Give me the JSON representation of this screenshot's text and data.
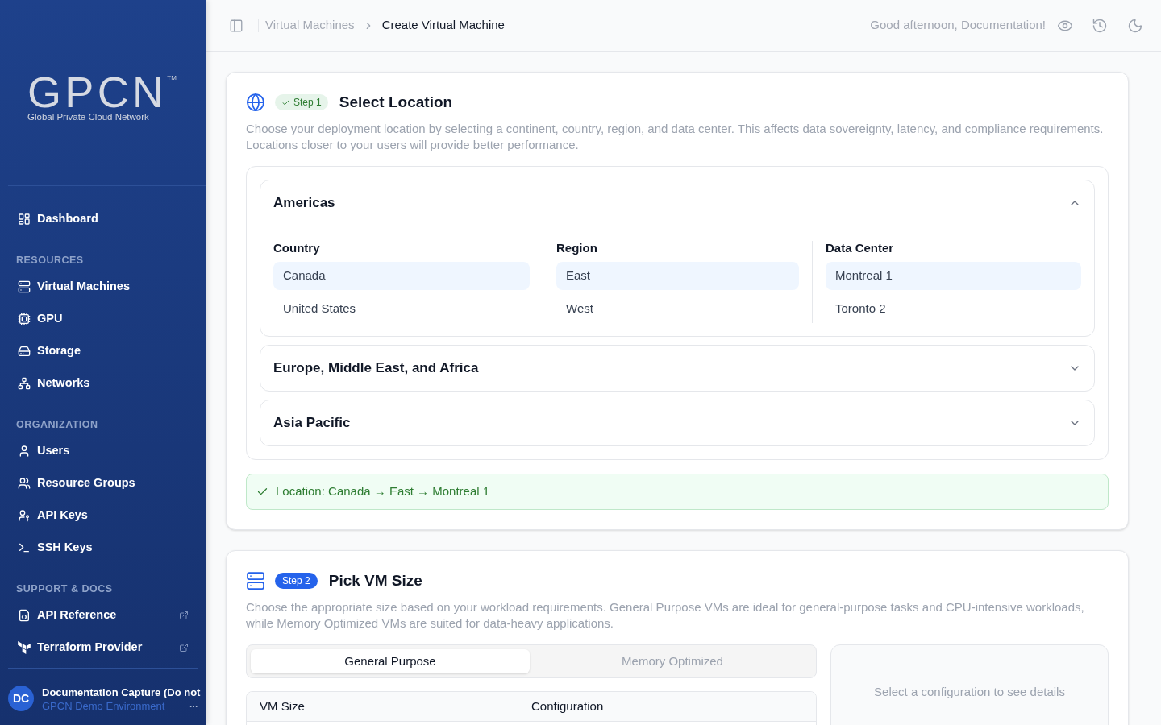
{
  "sidebar": {
    "logo": {
      "wordmark": "GPCN",
      "trademark": "TM",
      "tagline": "Global Private Cloud Network"
    },
    "sections": [
      {
        "items": [
          {
            "label": "Dashboard",
            "selected": false,
            "external": false
          }
        ]
      },
      {
        "heading": "RESOURCES",
        "items": [
          {
            "label": "Virtual Machines",
            "selected": false,
            "external": false
          },
          {
            "label": "GPU",
            "selected": false,
            "external": false
          },
          {
            "label": "Storage",
            "selected": false,
            "external": false
          },
          {
            "label": "Networks",
            "selected": false,
            "external": false
          }
        ]
      },
      {
        "heading": "ORGANIZATION",
        "items": [
          {
            "label": "Users",
            "selected": false,
            "external": false
          },
          {
            "label": "Resource Groups",
            "selected": false,
            "external": false
          },
          {
            "label": "API Keys",
            "selected": false,
            "external": false
          },
          {
            "label": "SSH Keys",
            "selected": false,
            "external": false
          }
        ]
      },
      {
        "heading": "SUPPORT & DOCS",
        "items": [
          {
            "label": "API Reference",
            "selected": false,
            "external": true
          },
          {
            "label": "Terraform Provider",
            "selected": false,
            "external": true
          }
        ]
      }
    ],
    "user": {
      "initials": "DC",
      "name": "Documentation Capture (Do not",
      "subtitle": "GPCN Demo Environment"
    }
  },
  "topbar": {
    "breadcrumb": [
      {
        "label": "Virtual Machines",
        "current": false
      },
      {
        "label": "Create Virtual Machine",
        "current": true
      }
    ],
    "greeting": "Good afternoon, Documentation!"
  },
  "location_step": {
    "badge": {
      "label": "Step 1",
      "completed": true
    },
    "title": "Select Location",
    "description": "Choose your deployment location by selecting a continent, country, region, and data center. This affects data sovereignty, latency, and compliance requirements. Locations closer to your users will provide better performance.",
    "continents": [
      {
        "name": "Americas",
        "expanded": true,
        "columns": [
          {
            "heading": "Country",
            "options": [
              {
                "label": "Canada",
                "selected": true
              },
              {
                "label": "United States",
                "selected": false
              }
            ]
          },
          {
            "heading": "Region",
            "options": [
              {
                "label": "East",
                "selected": true
              },
              {
                "label": "West",
                "selected": false
              }
            ]
          },
          {
            "heading": "Data Center",
            "options": [
              {
                "label": "Montreal 1",
                "selected": true
              },
              {
                "label": "Toronto 2",
                "selected": false
              }
            ]
          }
        ]
      },
      {
        "name": "Europe, Middle East, and Africa",
        "expanded": false
      },
      {
        "name": "Asia Pacific",
        "expanded": false
      }
    ],
    "summary": "Location: Canada → East → Montreal 1"
  },
  "size_step": {
    "badge": {
      "label": "Step 2",
      "completed": false
    },
    "title": "Pick VM Size",
    "description": "Choose the appropriate size based on your workload requirements. General Purpose VMs are ideal for general-purpose tasks and CPU-intensive workloads, while Memory Optimized VMs are suited for data-heavy applications.",
    "tabs": [
      {
        "label": "General Purpose",
        "selected": true
      },
      {
        "label": "Memory Optimized",
        "selected": false
      }
    ],
    "table": {
      "columns": [
        "VM Size",
        "Configuration"
      ]
    },
    "details_message": "Select a configuration to see details"
  }
}
